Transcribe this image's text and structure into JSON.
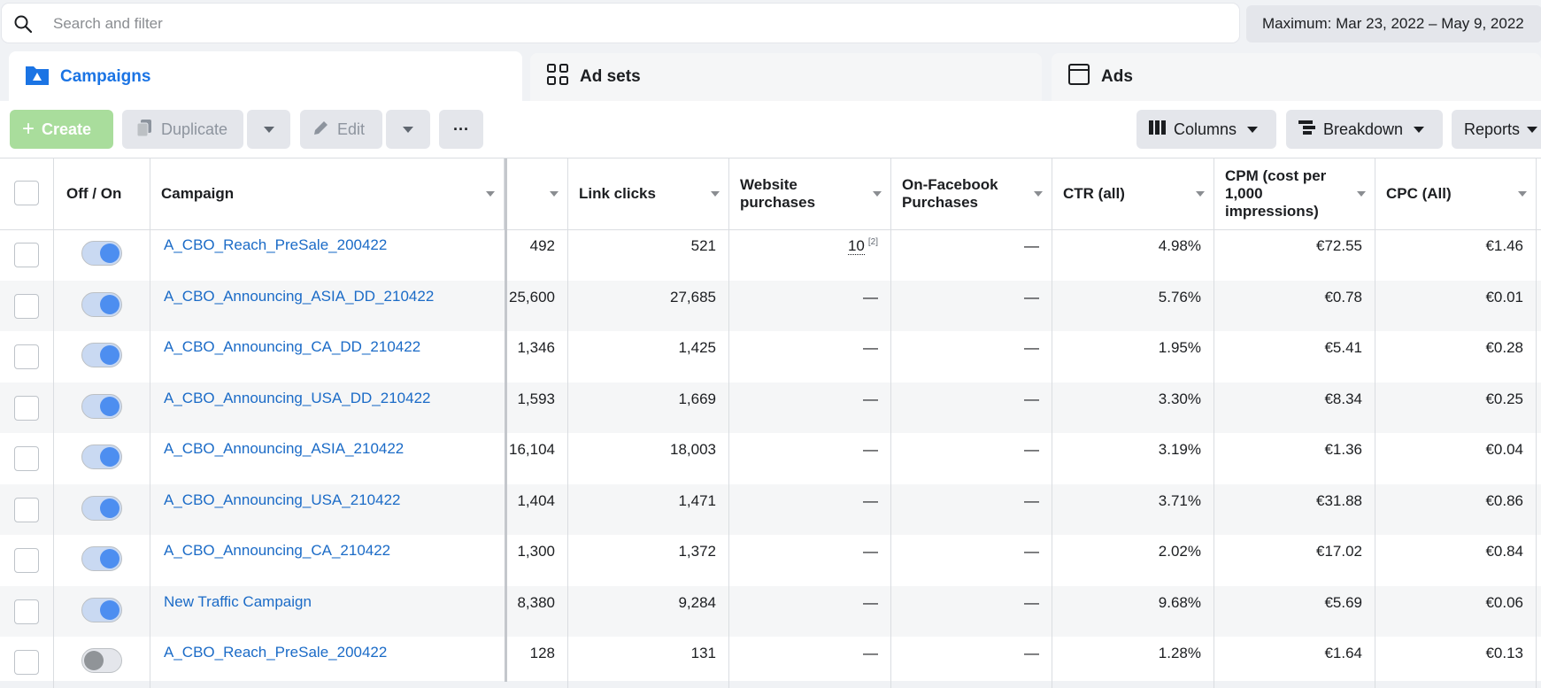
{
  "search": {
    "placeholder": "Search and filter"
  },
  "date_range": "Maximum: Mar 23, 2022 – May 9, 2022",
  "tabs": [
    {
      "label": "Campaigns",
      "icon": "campaigns-folder-icon",
      "active": true
    },
    {
      "label": "Ad sets",
      "icon": "grid-icon",
      "active": false
    },
    {
      "label": "Ads",
      "icon": "ad-window-icon",
      "active": false
    }
  ],
  "toolbar": {
    "create": "Create",
    "duplicate": "Duplicate",
    "edit": "Edit",
    "more": "···",
    "columns": "Columns",
    "breakdown": "Breakdown",
    "reports": "Reports"
  },
  "columns": {
    "off_on": "Off / On",
    "campaign": "Campaign",
    "metric": "",
    "link_clicks": "Link clicks",
    "website_purchases": "Website purchases",
    "on_facebook_purchases": "On-Facebook Purchases",
    "ctr": "CTR (all)",
    "cpm": "CPM (cost per 1,000 impressions)",
    "cpc": "CPC (All)"
  },
  "rows": [
    {
      "name": "A_CBO_Reach_PreSale_200422",
      "on": true,
      "metric": "492",
      "link_clicks": "521",
      "website_purchases": "10",
      "website_purchases_note": "[2]",
      "fb_purchases": "—",
      "ctr": "4.98%",
      "cpm": "€72.55",
      "cpc": "€1.46"
    },
    {
      "name": "A_CBO_Announcing_ASIA_DD_210422",
      "on": true,
      "metric": "25,600",
      "link_clicks": "27,685",
      "website_purchases": "—",
      "website_purchases_note": "",
      "fb_purchases": "—",
      "ctr": "5.76%",
      "cpm": "€0.78",
      "cpc": "€0.01"
    },
    {
      "name": "A_CBO_Announcing_CA_DD_210422",
      "on": true,
      "metric": "1,346",
      "link_clicks": "1,425",
      "website_purchases": "—",
      "website_purchases_note": "",
      "fb_purchases": "—",
      "ctr": "1.95%",
      "cpm": "€5.41",
      "cpc": "€0.28"
    },
    {
      "name": "A_CBO_Announcing_USA_DD_210422",
      "on": true,
      "metric": "1,593",
      "link_clicks": "1,669",
      "website_purchases": "—",
      "website_purchases_note": "",
      "fb_purchases": "—",
      "ctr": "3.30%",
      "cpm": "€8.34",
      "cpc": "€0.25"
    },
    {
      "name": "A_CBO_Announcing_ASIA_210422",
      "on": true,
      "metric": "16,104",
      "link_clicks": "18,003",
      "website_purchases": "—",
      "website_purchases_note": "",
      "fb_purchases": "—",
      "ctr": "3.19%",
      "cpm": "€1.36",
      "cpc": "€0.04"
    },
    {
      "name": "A_CBO_Announcing_USA_210422",
      "on": true,
      "metric": "1,404",
      "link_clicks": "1,471",
      "website_purchases": "—",
      "website_purchases_note": "",
      "fb_purchases": "—",
      "ctr": "3.71%",
      "cpm": "€31.88",
      "cpc": "€0.86"
    },
    {
      "name": "A_CBO_Announcing_CA_210422",
      "on": true,
      "metric": "1,300",
      "link_clicks": "1,372",
      "website_purchases": "—",
      "website_purchases_note": "",
      "fb_purchases": "—",
      "ctr": "2.02%",
      "cpm": "€17.02",
      "cpc": "€0.84"
    },
    {
      "name": "New Traffic Campaign",
      "on": true,
      "metric": "8,380",
      "link_clicks": "9,284",
      "website_purchases": "—",
      "website_purchases_note": "",
      "fb_purchases": "—",
      "ctr": "9.68%",
      "cpm": "€5.69",
      "cpc": "€0.06"
    },
    {
      "name": "A_CBO_Reach_PreSale_200422",
      "on": false,
      "metric": "128",
      "link_clicks": "131",
      "website_purchases": "—",
      "website_purchases_note": "",
      "fb_purchases": "—",
      "ctr": "1.28%",
      "cpm": "€1.64",
      "cpc": "€0.13"
    }
  ]
}
